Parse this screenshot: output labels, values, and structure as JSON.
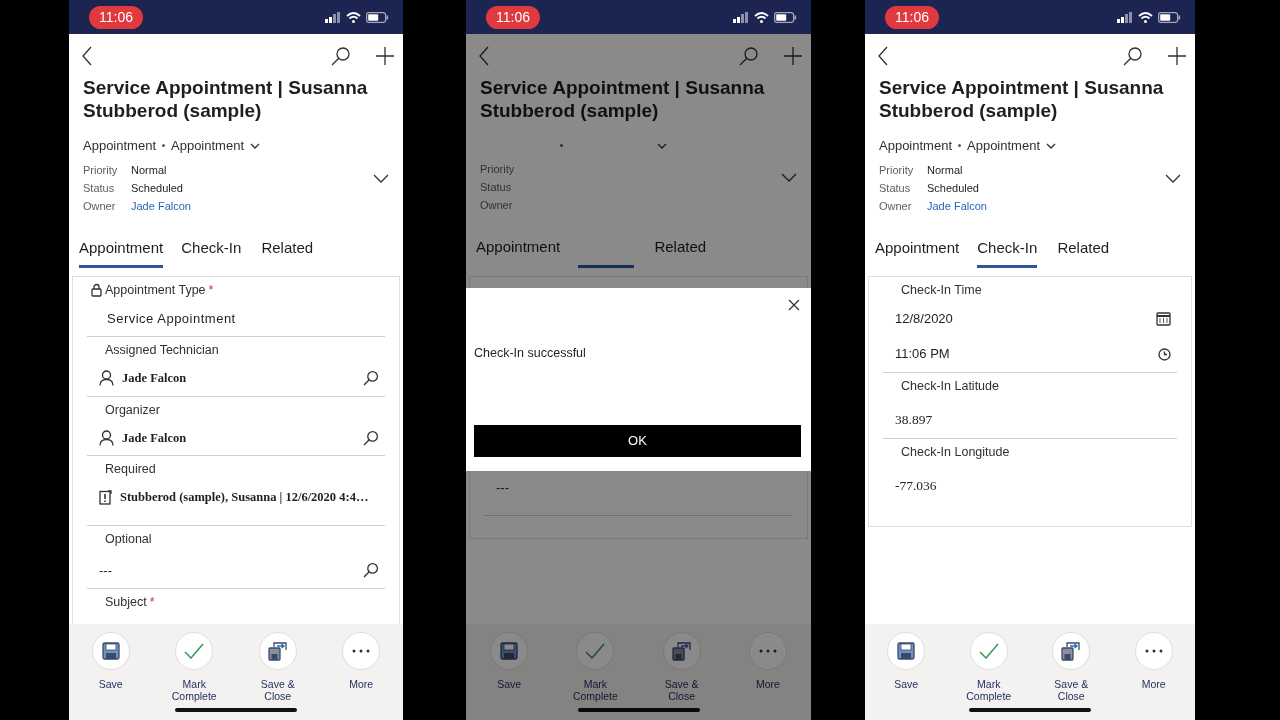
{
  "screens": [
    {
      "status_bar": {
        "time": "11:06"
      },
      "title": "Service Appointment |  Susanna Stubberod (sample)",
      "breadcrumb": [
        "Appointment",
        "Appointment"
      ],
      "header_fields": [
        {
          "label": "Priority",
          "value": "Normal",
          "kind": "text"
        },
        {
          "label": "Status",
          "value": "Scheduled",
          "kind": "text"
        },
        {
          "label": "Owner",
          "value": "Jade Falcon",
          "kind": "link"
        }
      ],
      "tabs": [
        {
          "label": "Appointment",
          "selected": true
        },
        {
          "label": "Check-In",
          "selected": false
        },
        {
          "label": "Related",
          "selected": false
        }
      ],
      "fields": [
        {
          "kind": "option",
          "label": "Appointment Type",
          "required_mark": "*",
          "locked": true,
          "value": "Service Appointment"
        },
        {
          "kind": "user-lookup",
          "label": "Assigned Technician",
          "value": "Jade Falcon"
        },
        {
          "kind": "user-lookup",
          "label": "Organizer",
          "value": "Jade Falcon"
        },
        {
          "kind": "record-lookup",
          "label": "Required",
          "value": "Stubberod (sample), Susanna | 12/6/2020 4:4…"
        },
        {
          "kind": "empty-lookup",
          "label": "Optional",
          "value": "---"
        },
        {
          "kind": "heading",
          "label": "Subject",
          "required_mark": "*"
        }
      ],
      "commands": [
        {
          "kind": "save",
          "label": "Save"
        },
        {
          "kind": "complete",
          "label": "Mark Complete"
        },
        {
          "kind": "save-close",
          "label": "Save & Close"
        },
        {
          "kind": "more",
          "label": "More"
        }
      ]
    },
    {
      "status_bar": {
        "time": "11:06"
      },
      "title": "Service Appointment |  Susanna Stubberod (sample)",
      "header_fields": [
        {
          "label": "Priority",
          "kind": "text"
        },
        {
          "label": "Status",
          "kind": "text"
        },
        {
          "label": "Owner",
          "kind": "link"
        }
      ],
      "tabs": [
        {
          "label": "Appointment",
          "selected": false
        },
        {
          "selected": true
        },
        {
          "label": "Related",
          "selected": false
        }
      ],
      "fields": [
        {
          "kind": "plain",
          "value": "---"
        }
      ],
      "commands": [
        {
          "kind": "save",
          "label": "Save"
        },
        {
          "kind": "complete",
          "label": "Mark Complete"
        },
        {
          "kind": "save-close",
          "label": "Save & Close"
        },
        {
          "kind": "more",
          "label": "More"
        }
      ],
      "dialog": {
        "message": "Check-In successful",
        "button": "OK"
      }
    },
    {
      "status_bar": {
        "time": "11:06"
      },
      "title": "Service Appointment |  Susanna Stubberod (sample)",
      "breadcrumb": [
        "Appointment",
        "Appointment"
      ],
      "header_fields": [
        {
          "label": "Priority",
          "value": "Normal",
          "kind": "text"
        },
        {
          "label": "Status",
          "value": "Scheduled",
          "kind": "text"
        },
        {
          "label": "Owner",
          "value": "Jade Falcon",
          "kind": "link"
        }
      ],
      "tabs": [
        {
          "label": "Appointment",
          "selected": false
        },
        {
          "label": "Check-In",
          "selected": true
        },
        {
          "label": "Related",
          "selected": false
        }
      ],
      "fields": [
        {
          "kind": "datetime",
          "label": "Check-In Time",
          "date": "12/8/2020",
          "time": "11:06 PM"
        },
        {
          "kind": "number",
          "label": "Check-In Latitude",
          "value": "38.897"
        },
        {
          "kind": "number",
          "label": "Check-In Longitude",
          "value": "-77.036"
        }
      ],
      "commands": [
        {
          "kind": "save",
          "label": "Save"
        },
        {
          "kind": "complete",
          "label": "Mark Complete"
        },
        {
          "kind": "save-close",
          "label": "Save & Close"
        },
        {
          "kind": "more",
          "label": "More"
        }
      ]
    }
  ]
}
